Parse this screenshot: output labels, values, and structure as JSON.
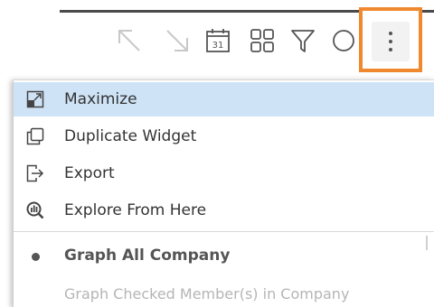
{
  "toolbar": {
    "icons": [
      "arrow-up-left-icon",
      "arrow-down-right-icon",
      "calendar-icon",
      "grid-icon",
      "filter-icon",
      "search-icon",
      "more-vertical-icon"
    ],
    "calendar_day": "31",
    "highlight_color": "#f0882e"
  },
  "menu": {
    "items": [
      {
        "label": "Maximize",
        "icon": "maximize-icon"
      },
      {
        "label": "Duplicate Widget",
        "icon": "duplicate-icon"
      },
      {
        "label": "Export",
        "icon": "export-icon"
      },
      {
        "label": "Explore From Here",
        "icon": "explore-icon"
      }
    ],
    "options": [
      {
        "label": "Graph All Company",
        "selected": true
      },
      {
        "label": "Graph Checked Member(s) in Company",
        "selected": false
      }
    ],
    "highlight_color": "#cfe3f6"
  }
}
